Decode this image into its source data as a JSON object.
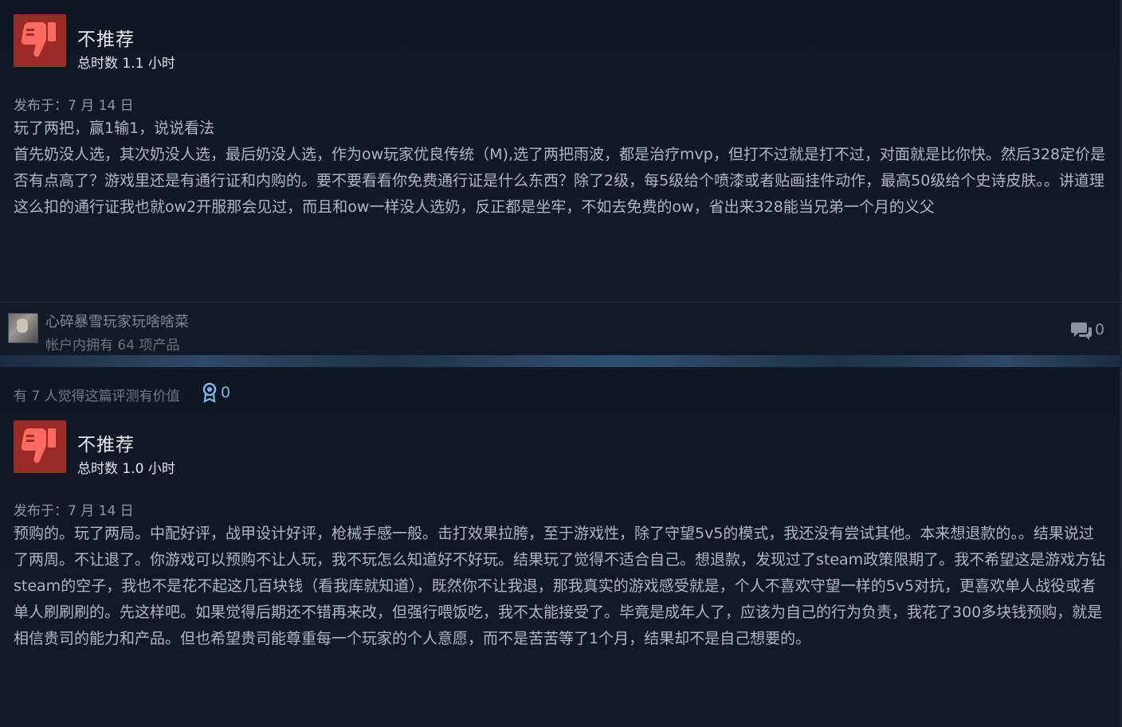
{
  "reviews": [
    {
      "verdict": "不推荐",
      "playtime": "总时数 1.1 小时",
      "posted": "发布于：7 月 14 日",
      "body": [
        "玩了两把，赢1输1，说说看法",
        "首先奶没人选，其次奶没人选，最后奶没人选，作为ow玩家优良传统（M),选了两把雨波，都是治疗mvp，但打不过就是打不过，对面就是比你快。然后328定价是否有点高了？游戏里还是有通行证和内购的。要不要看看你免费通行证是什么东西？除了2级，每5级给个喷漆或者贴画挂件动作，最高50级给个史诗皮肤。。讲道理这么扣的通行证我也就ow2开服那会见过，而且和ow一样没人选奶，反正都是坐牢，不如去免费的ow，省出来328能当兄弟一个月的义父"
      ],
      "author_name": "心碎暴雪玩家玩啥啥菜",
      "author_owned": "帐户内拥有 64 项产品",
      "comments": "0"
    },
    {
      "helpful_text": "有 7 人觉得这篇评测有价值",
      "awards": "0",
      "verdict": "不推荐",
      "playtime": "总时数 1.0 小时",
      "posted": "发布于：7 月 14 日",
      "body": [
        "预购的。玩了两局。中配好评，战甲设计好评，枪械手感一般。击打效果拉胯，至于游戏性，除了守望5v5的模式，我还没有尝试其他。本来想退款的。。结果说过了两周。不让退了。你游戏可以预购不让人玩，我不玩怎么知道好不好玩。结果玩了觉得不适合自己。想退款，发现过了steam政策限期了。我不希望这是游戏方钻steam的空子，我也不是花不起这几百块钱（看我库就知道），既然你不让我退，那我真实的游戏感受就是，个人不喜欢守望一样的5v5对抗，更喜欢单人战役或者单人刷刷刷的。先这样吧。如果觉得后期还不错再来改，但强行喂饭吃，我不太能接受了。毕竟是成年人了，应该为自己的行为负责，我花了300多块钱预购，就是相信贵司的能力和产品。但也希望贵司能尊重每一个玩家的个人意愿，而不是苦苦等了1个月，结果却不是自己想要的。"
      ]
    }
  ],
  "colors": {
    "thumb_bg": "#9b2b26",
    "thumb_fg": "#ff6b60",
    "award": "#7fb6e8"
  },
  "icons": {
    "verdict": "thumbs-down-icon",
    "comment": "speech-bubbles-icon",
    "award": "award-ribbon-icon"
  }
}
